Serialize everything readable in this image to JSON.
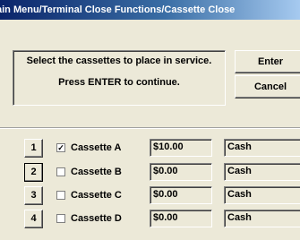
{
  "window": {
    "title": "ain Menu/Terminal Close Functions/Cassette Close"
  },
  "message": {
    "line1": "Select the cassettes to place in service.",
    "line2": "Press ENTER to continue."
  },
  "buttons": {
    "enter": "Enter",
    "cancel": "Cancel"
  },
  "cassettes": [
    {
      "number": "1",
      "label": "Cassette A",
      "checked": true,
      "check_glyph": "✓",
      "amount": "$10.00",
      "type": "Cash"
    },
    {
      "number": "2",
      "label": "Cassette B",
      "checked": false,
      "check_glyph": "",
      "amount": "$0.00",
      "type": "Cash"
    },
    {
      "number": "3",
      "label": "Cassette C",
      "checked": false,
      "check_glyph": "",
      "amount": "$0.00",
      "type": "Cash"
    },
    {
      "number": "4",
      "label": "Cassette D",
      "checked": false,
      "check_glyph": "",
      "amount": "$0.00",
      "type": "Cash"
    }
  ]
}
